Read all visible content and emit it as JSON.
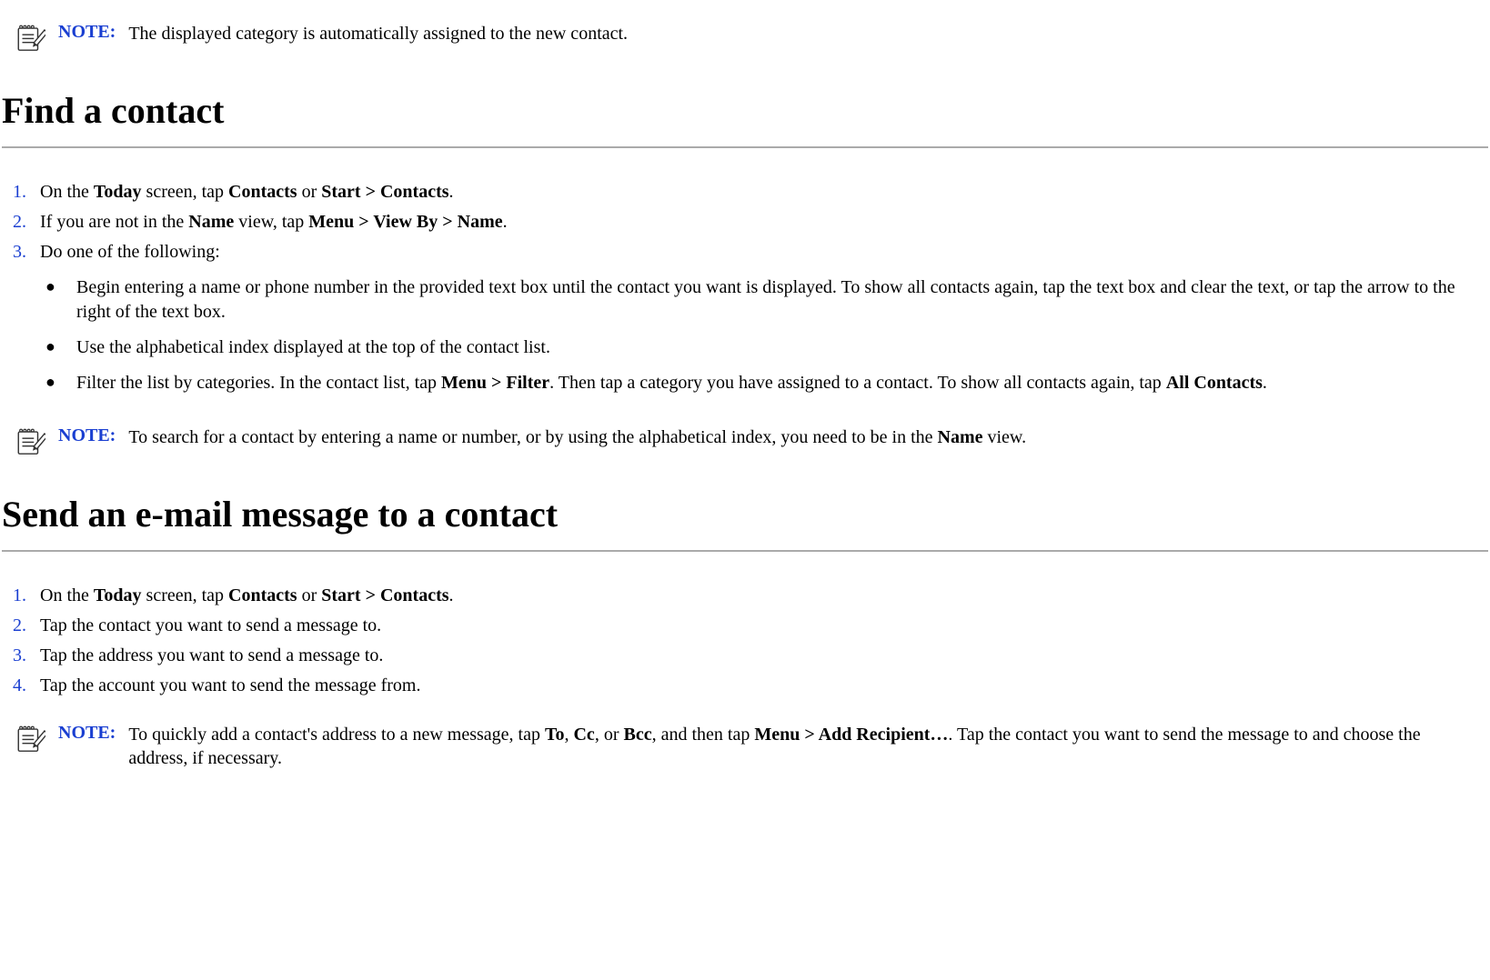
{
  "note_label": "NOTE:",
  "note1": {
    "parts": [
      "The displayed category is automatically assigned to the new contact."
    ]
  },
  "heading_find": "Find a contact",
  "find_steps": [
    {
      "num": "1.",
      "parts": [
        "On the ",
        [
          "b",
          "Today"
        ],
        " screen, tap ",
        [
          "b",
          "Contacts"
        ],
        " or ",
        [
          "b",
          "Start > Contacts"
        ],
        "."
      ]
    },
    {
      "num": "2.",
      "parts": [
        "If you are not in the ",
        [
          "b",
          "Name"
        ],
        " view, tap ",
        [
          "b",
          "Menu > View By > Name"
        ],
        "."
      ]
    },
    {
      "num": "3.",
      "parts": [
        "Do one of the following:"
      ],
      "sub": [
        {
          "parts": [
            "Begin entering a name or phone number in the provided text box until the contact you want is displayed. To show all contacts again, tap the text box and clear the text, or tap the arrow to the right of the text box."
          ]
        },
        {
          "parts": [
            "Use the alphabetical index displayed at the top of the contact list."
          ]
        },
        {
          "parts": [
            "Filter the list by categories. In the contact list, tap ",
            [
              "b",
              "Menu > Filter"
            ],
            ". Then tap a category you have assigned to a contact. To show all contacts again, tap ",
            [
              "b",
              "All Contacts"
            ],
            "."
          ]
        }
      ]
    }
  ],
  "note2": {
    "parts": [
      "To search for a contact by entering a name or number, or by using the alphabetical index, you need to be in the ",
      [
        "b",
        "Name"
      ],
      " view."
    ]
  },
  "heading_send": "Send an e-mail message to a contact",
  "send_steps": [
    {
      "num": "1.",
      "parts": [
        "On the ",
        [
          "b",
          "Today"
        ],
        " screen, tap ",
        [
          "b",
          "Contacts"
        ],
        " or ",
        [
          "b",
          "Start > Contacts"
        ],
        "."
      ]
    },
    {
      "num": "2.",
      "parts": [
        "Tap the contact you want to send a message to."
      ]
    },
    {
      "num": "3.",
      "parts": [
        "Tap the address you want to send a message to."
      ]
    },
    {
      "num": "4.",
      "parts": [
        "Tap the account you want to send the message from."
      ]
    }
  ],
  "note3": {
    "parts": [
      "To quickly add a contact's address to a new message, tap ",
      [
        "b",
        "To"
      ],
      ", ",
      [
        "b",
        "Cc"
      ],
      ", or ",
      [
        "b",
        "Bcc"
      ],
      ", and then tap ",
      [
        "b",
        "Menu > Add Recipient…"
      ],
      ". Tap the contact you want to send the message to and choose the address, if necessary."
    ]
  }
}
